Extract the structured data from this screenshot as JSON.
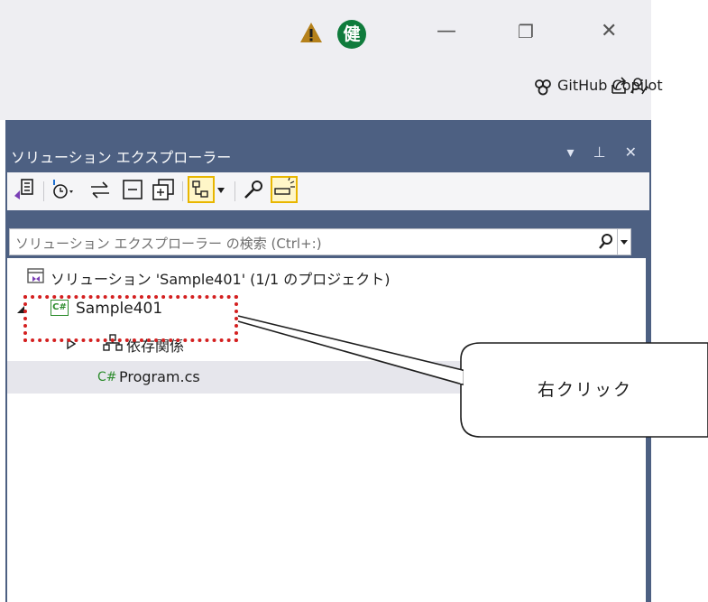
{
  "window": {
    "user_initial": "健",
    "minimize_glyph": "—",
    "restore_glyph": "❐",
    "close_glyph": "✕",
    "copilot_label": "GitHub Copilot"
  },
  "panel": {
    "title": "ソリューション エクスプローラー",
    "header_controls": "▾ ⊥ ✕",
    "search_placeholder": "ソリューション エクスプローラー の検索 (Ctrl+:)"
  },
  "tree": {
    "solution_label": "ソリューション 'Sample401' (1/1 のプロジェクト)",
    "project_label": "Sample401",
    "dependencies_label": "依存関係",
    "file_label": "Program.cs",
    "file_icon_text": "C#",
    "project_icon_text": "C#"
  },
  "annotation": {
    "callout_text": "右クリック"
  },
  "colors": {
    "panel_header_bg": "#4d6082",
    "titlebar_bg": "#eeeef2",
    "csharp_green": "#2d8c2d",
    "highlight_red": "#d42020"
  }
}
